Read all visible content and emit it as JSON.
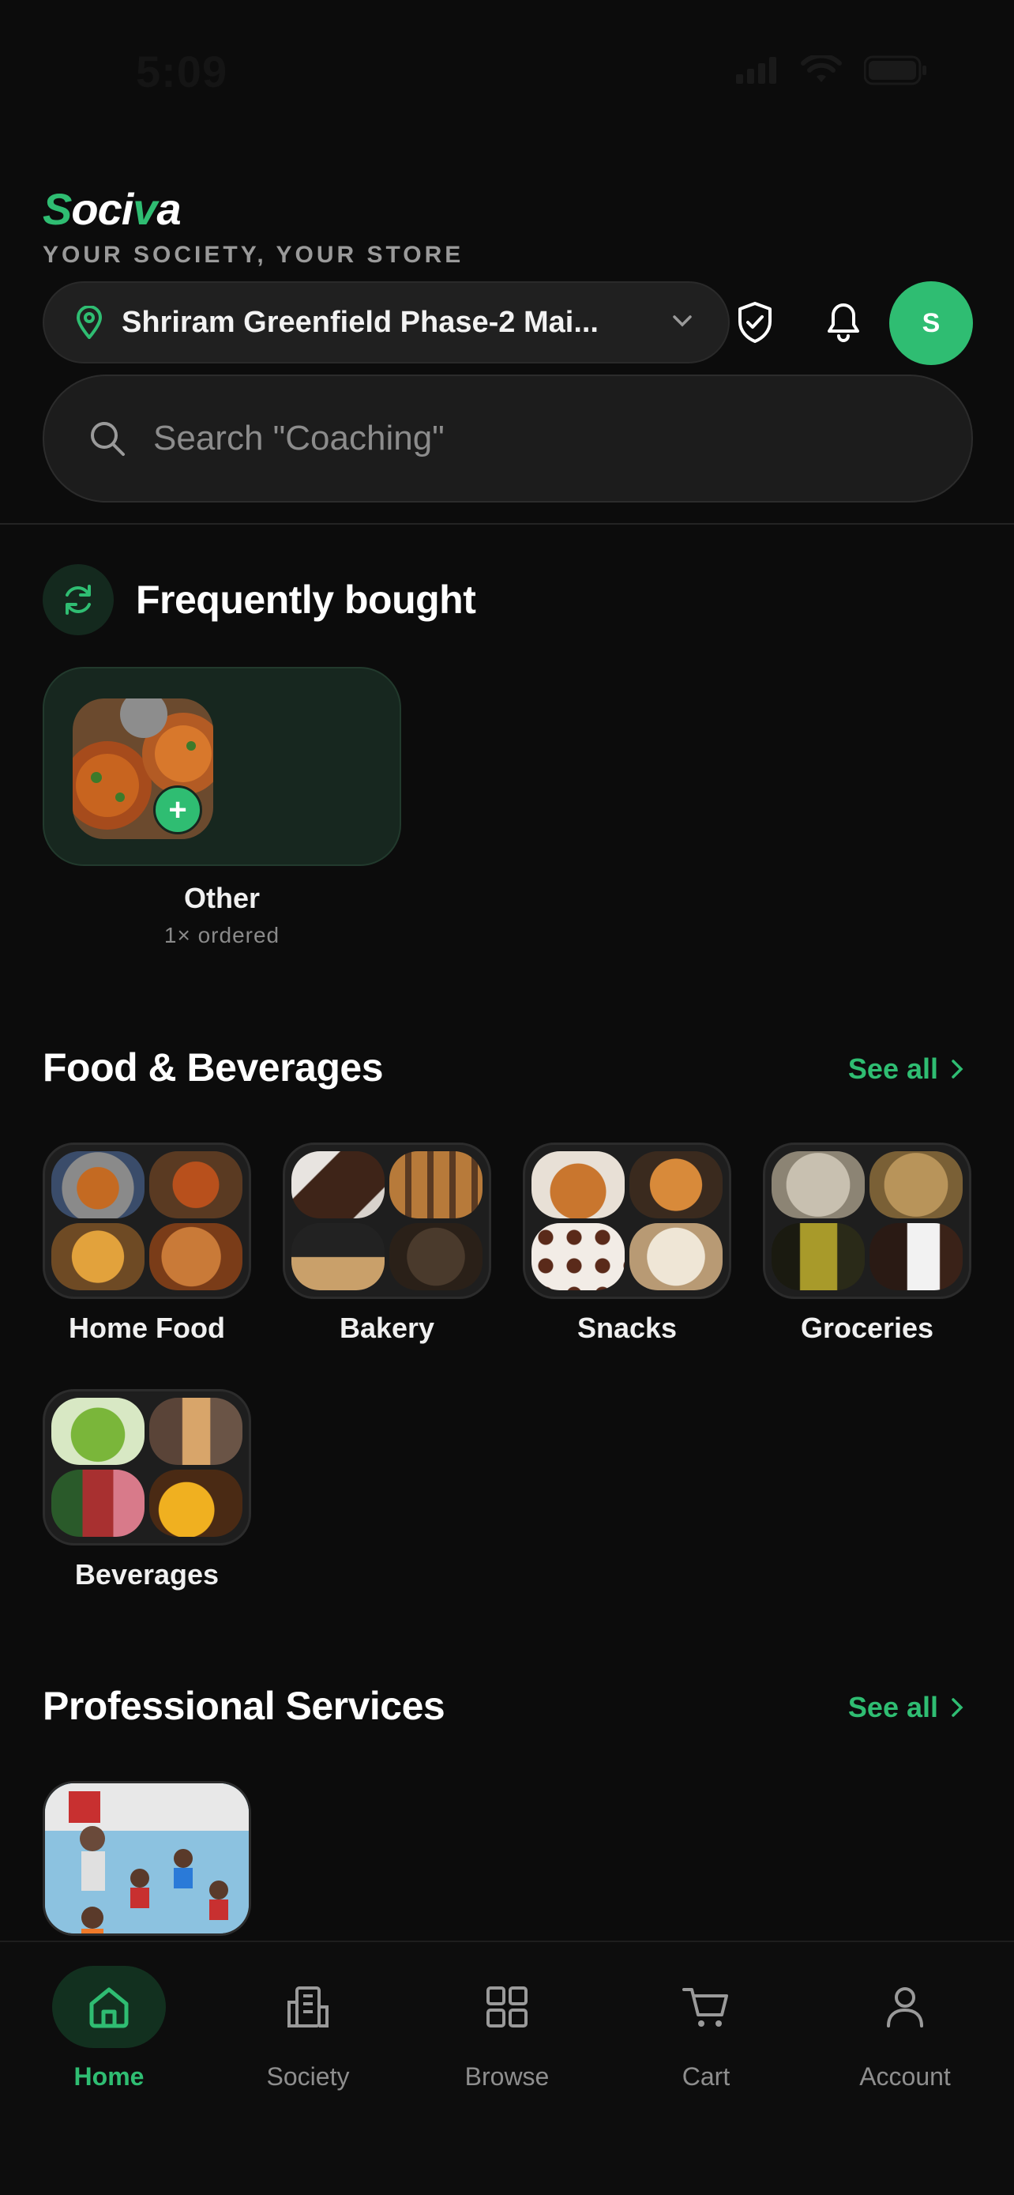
{
  "status": {
    "time": "5:09"
  },
  "header": {
    "brand": "Sociva",
    "tagline": "YOUR SOCIETY, YOUR STORE",
    "location": "Shriram Greenfield Phase-2 Mai...",
    "avatar_initial": "S"
  },
  "search": {
    "placeholder": "Search \"Coaching\""
  },
  "frequently_bought": {
    "title": "Frequently bought",
    "items": [
      {
        "label": "Other",
        "sub": "1× ordered"
      }
    ]
  },
  "food_beverages": {
    "title": "Food & Beverages",
    "see_all": "See all",
    "categories": [
      {
        "label": "Home Food"
      },
      {
        "label": "Bakery"
      },
      {
        "label": "Snacks"
      },
      {
        "label": "Groceries"
      },
      {
        "label": "Beverages"
      }
    ]
  },
  "professional_services": {
    "title": "Professional Services",
    "see_all": "See all"
  },
  "tabs": [
    {
      "label": "Home",
      "icon": "home-icon",
      "active": true
    },
    {
      "label": "Society",
      "icon": "building-icon",
      "active": false
    },
    {
      "label": "Browse",
      "icon": "grid-icon",
      "active": false
    },
    {
      "label": "Cart",
      "icon": "cart-icon",
      "active": false
    },
    {
      "label": "Account",
      "icon": "user-icon",
      "active": false
    }
  ],
  "colors": {
    "accent": "#2fbd72",
    "background": "#0c0c0c"
  }
}
